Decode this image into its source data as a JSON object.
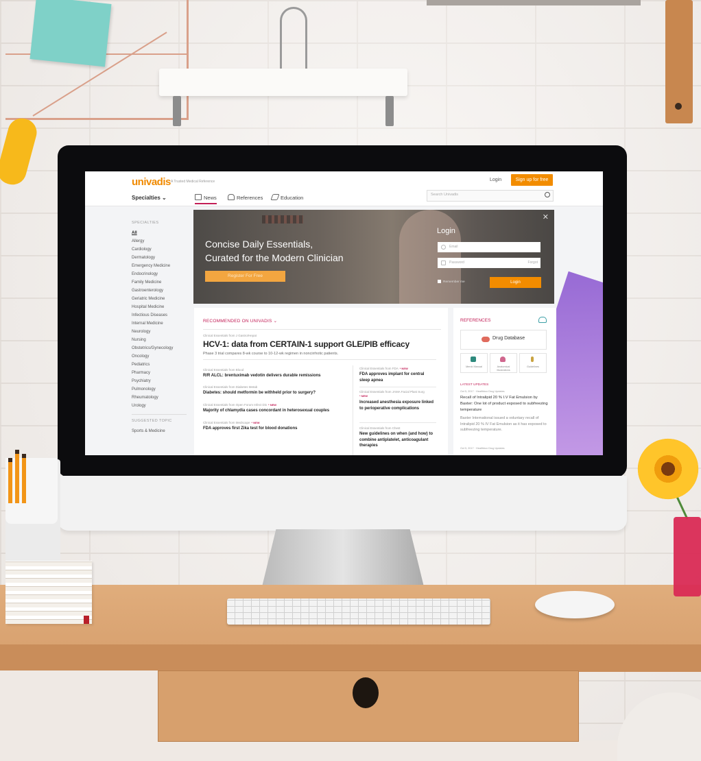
{
  "header": {
    "logo": "univadis",
    "tagline": "A Trusted Medical Reference",
    "login_link": "Login",
    "signup_button": "Sign up for free",
    "specialties_dropdown": "Specialties",
    "tabs": [
      {
        "label": "News"
      },
      {
        "label": "References"
      },
      {
        "label": "Education"
      }
    ],
    "search_placeholder": "Search Univadis"
  },
  "sidebar": {
    "heading": "SPECIALTIES",
    "items": [
      {
        "label": "All"
      },
      {
        "label": "Allergy"
      },
      {
        "label": "Cardiology"
      },
      {
        "label": "Dermatology"
      },
      {
        "label": "Emergency Medicine"
      },
      {
        "label": "Endocrinology"
      },
      {
        "label": "Family Medicine"
      },
      {
        "label": "Gastroenterology"
      },
      {
        "label": "Geriatric Medicine"
      },
      {
        "label": "Hospital Medicine"
      },
      {
        "label": "Infectious Diseases"
      },
      {
        "label": "Internal Medicine"
      },
      {
        "label": "Neurology"
      },
      {
        "label": "Nursing"
      },
      {
        "label": "Obstetrics/Gynecology"
      },
      {
        "label": "Oncology"
      },
      {
        "label": "Pediatrics"
      },
      {
        "label": "Pharmacy"
      },
      {
        "label": "Psychiatry"
      },
      {
        "label": "Pulmonology"
      },
      {
        "label": "Rheumatology"
      },
      {
        "label": "Urology"
      }
    ],
    "suggested_heading": "SUGGESTED TOPIC",
    "suggested_items": [
      {
        "label": "Sports & Medicine"
      }
    ]
  },
  "hero": {
    "title_line1": "Concise Daily Essentials,",
    "title_line2": "Curated for the Modern Clinician",
    "register_button": "Register For Free",
    "close": "✕",
    "login": {
      "title": "Login",
      "email_placeholder": "Email",
      "password_placeholder": "Password",
      "forgot": "Forgot",
      "remember": "Remember me",
      "submit": "Login"
    }
  },
  "feed": {
    "section_label": "RECOMMENDED ON UNIVADIS",
    "main_kicker": "Clinical Essentials from J Gastro/Hepat",
    "main_headline": "HCV-1: data from CERTAIN-1 support GLE/PIB efficacy",
    "main_summary": "Phase 3 trial compares 8-wk course to 10-12-wk regimen in noncirrhotic patients.",
    "new_tag": "* NEW",
    "left_stories": [
      {
        "kicker": "Clinical Essentials from Blood",
        "headline": "R/R ALCL: brentuximab vedotin delivers durable remissions",
        "is_new": false
      },
      {
        "kicker": "Clinical Essentials from Diabetes Metab",
        "headline": "Diabetes: should metformin be withheld prior to surgery?",
        "is_new": false
      },
      {
        "kicker": "Clinical Essentials from Open Forum Infect Dis",
        "headline": "Majority of chlamydia cases concordant in heterosexual couples",
        "is_new": true
      },
      {
        "kicker": "Clinical Essentials from Medscape",
        "headline": "FDA approves first Zika test for blood donations",
        "is_new": true
      }
    ],
    "right_stories": [
      {
        "kicker": "Clinical Essentials from FDA",
        "headline": "FDA approves implant for central sleep apnea",
        "is_new": true
      },
      {
        "kicker": "Clinical Essentials from JAMA Facial Plast Surg",
        "headline": "Increased anesthesia exposure linked to perioperative complications",
        "is_new": true
      },
      {
        "kicker": "Clinical Essentials from Chest",
        "headline": "New guidelines on when (and how) to combine antiplatelet, anticoagulant therapies",
        "is_new": false
      }
    ]
  },
  "references": {
    "heading": "REFERENCES",
    "drug_database": "Drug Database",
    "tools": [
      {
        "label": "Merck Manual",
        "icon": "book-icon"
      },
      {
        "label": "Anatomical Illustrations",
        "icon": "lungs-icon"
      },
      {
        "label": "Guidelines",
        "icon": "caduceus-icon"
      }
    ],
    "latest_heading": "LATEST UPDATES",
    "updates": [
      {
        "meta": "Oct 5, 2017 · Healthbox Drug Updates",
        "title": "Recall of Intralipid 20 % I.V Fat Emulsion by Baxter: One lot of product exposed to subfreezing temperature",
        "body": "Baxter International issued a voluntary recall of Intralipid 20 % IV Fat Emulsion as it has exposed to subfreezing temperature."
      },
      {
        "meta": "Oct 5, 2017 · Healthbox Drug Updates"
      }
    ]
  },
  "colors": {
    "brand_orange": "#f28c00",
    "accent_crimson": "#c21e56",
    "links_teal": "#3a9ea5"
  }
}
